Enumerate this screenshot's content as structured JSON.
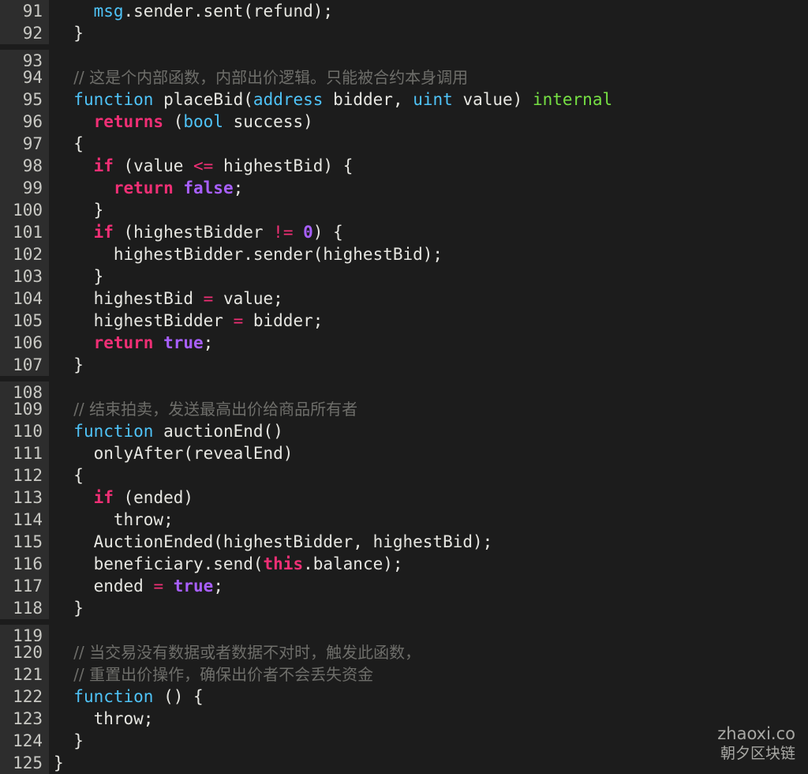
{
  "editor": {
    "language": "solidity",
    "first_line_number": 91,
    "last_line_number": 125,
    "background_color": "#1c1c1c",
    "gutter_color": "#2d2d2d",
    "gutter_text_color": "#c9c9c4"
  },
  "theme": {
    "default": "#e6e6e1",
    "keyword": "#4fc3f7",
    "identifier": "#76e043",
    "control": "#ef2f75",
    "literal": "#a85fff",
    "comment": "#6e6e6a"
  },
  "watermark": {
    "line1": "zhaoxi.co",
    "line2": "朝夕区块链"
  },
  "lines": [
    {
      "num": "91",
      "tokens": [
        {
          "t": "    ",
          "c": "default"
        },
        {
          "t": "msg",
          "c": "builtin"
        },
        {
          "t": ".sender.sent(refund);",
          "c": "default"
        }
      ]
    },
    {
      "num": "92",
      "tokens": [
        {
          "t": "  }",
          "c": "default"
        }
      ]
    },
    {
      "num": "93",
      "tokens": [
        {
          "t": "",
          "c": "default"
        }
      ]
    },
    {
      "num": "94",
      "tokens": [
        {
          "t": "  ",
          "c": "default"
        },
        {
          "t": "// 这是个内部函数，内部出价逻辑。只能被合约本身调用",
          "c": "comment",
          "cjk": true
        }
      ]
    },
    {
      "num": "95",
      "tokens": [
        {
          "t": "  ",
          "c": "default"
        },
        {
          "t": "function",
          "c": "keyword"
        },
        {
          "t": " ",
          "c": "default"
        },
        {
          "t": "placeBid",
          "c": "identifier"
        },
        {
          "t": "(",
          "c": "default"
        },
        {
          "t": "address",
          "c": "type"
        },
        {
          "t": " bidder, ",
          "c": "default"
        },
        {
          "t": "uint",
          "c": "type"
        },
        {
          "t": " value) ",
          "c": "default"
        },
        {
          "t": "internal",
          "c": "modifier"
        }
      ]
    },
    {
      "num": "96",
      "tokens": [
        {
          "t": "    ",
          "c": "default"
        },
        {
          "t": "returns",
          "c": "control"
        },
        {
          "t": " (",
          "c": "default"
        },
        {
          "t": "bool",
          "c": "type"
        },
        {
          "t": " success)",
          "c": "default"
        }
      ]
    },
    {
      "num": "97",
      "tokens": [
        {
          "t": "  {",
          "c": "default"
        }
      ]
    },
    {
      "num": "98",
      "tokens": [
        {
          "t": "    ",
          "c": "default"
        },
        {
          "t": "if",
          "c": "control"
        },
        {
          "t": " (value ",
          "c": "default"
        },
        {
          "t": "<=",
          "c": "operator"
        },
        {
          "t": " highestBid) {",
          "c": "default"
        }
      ]
    },
    {
      "num": "99",
      "tokens": [
        {
          "t": "      ",
          "c": "default"
        },
        {
          "t": "return",
          "c": "control"
        },
        {
          "t": " ",
          "c": "default"
        },
        {
          "t": "false",
          "c": "literal"
        },
        {
          "t": ";",
          "c": "default"
        }
      ]
    },
    {
      "num": "100",
      "tokens": [
        {
          "t": "    }",
          "c": "default"
        }
      ]
    },
    {
      "num": "101",
      "tokens": [
        {
          "t": "    ",
          "c": "default"
        },
        {
          "t": "if",
          "c": "control"
        },
        {
          "t": " (highestBidder ",
          "c": "default"
        },
        {
          "t": "!=",
          "c": "operator"
        },
        {
          "t": " ",
          "c": "default"
        },
        {
          "t": "0",
          "c": "literal"
        },
        {
          "t": ") {",
          "c": "default"
        }
      ]
    },
    {
      "num": "102",
      "tokens": [
        {
          "t": "      highestBidder.sender(highestBid);",
          "c": "default"
        }
      ]
    },
    {
      "num": "103",
      "tokens": [
        {
          "t": "    }",
          "c": "default"
        }
      ]
    },
    {
      "num": "104",
      "tokens": [
        {
          "t": "    highestBid ",
          "c": "default"
        },
        {
          "t": "=",
          "c": "operator"
        },
        {
          "t": " value;",
          "c": "default"
        }
      ]
    },
    {
      "num": "105",
      "tokens": [
        {
          "t": "    highestBidder ",
          "c": "default"
        },
        {
          "t": "=",
          "c": "operator"
        },
        {
          "t": " bidder;",
          "c": "default"
        }
      ]
    },
    {
      "num": "106",
      "tokens": [
        {
          "t": "    ",
          "c": "default"
        },
        {
          "t": "return",
          "c": "control"
        },
        {
          "t": " ",
          "c": "default"
        },
        {
          "t": "true",
          "c": "literal"
        },
        {
          "t": ";",
          "c": "default"
        }
      ]
    },
    {
      "num": "107",
      "tokens": [
        {
          "t": "  }",
          "c": "default"
        }
      ]
    },
    {
      "num": "108",
      "tokens": [
        {
          "t": "",
          "c": "default"
        }
      ]
    },
    {
      "num": "109",
      "tokens": [
        {
          "t": "  ",
          "c": "default"
        },
        {
          "t": "// 结束拍卖，发送最高出价给商品所有者",
          "c": "comment",
          "cjk": true
        }
      ]
    },
    {
      "num": "110",
      "tokens": [
        {
          "t": "  ",
          "c": "default"
        },
        {
          "t": "function",
          "c": "keyword"
        },
        {
          "t": " ",
          "c": "default"
        },
        {
          "t": "auctionEnd",
          "c": "identifier"
        },
        {
          "t": "()",
          "c": "default"
        }
      ]
    },
    {
      "num": "111",
      "tokens": [
        {
          "t": "    ",
          "c": "default"
        },
        {
          "t": "onlyAfter",
          "c": "identifier"
        },
        {
          "t": "(revealEnd)",
          "c": "default"
        }
      ]
    },
    {
      "num": "112",
      "tokens": [
        {
          "t": "  {",
          "c": "default"
        }
      ]
    },
    {
      "num": "113",
      "tokens": [
        {
          "t": "    ",
          "c": "default"
        },
        {
          "t": "if",
          "c": "control"
        },
        {
          "t": " (ended)",
          "c": "default"
        }
      ]
    },
    {
      "num": "114",
      "tokens": [
        {
          "t": "      throw;",
          "c": "default"
        }
      ]
    },
    {
      "num": "115",
      "tokens": [
        {
          "t": "    AuctionEnded(highestBidder, highestBid);",
          "c": "default"
        }
      ]
    },
    {
      "num": "116",
      "tokens": [
        {
          "t": "    beneficiary.send(",
          "c": "default"
        },
        {
          "t": "this",
          "c": "control"
        },
        {
          "t": ".balance);",
          "c": "default"
        }
      ]
    },
    {
      "num": "117",
      "tokens": [
        {
          "t": "    ended ",
          "c": "default"
        },
        {
          "t": "=",
          "c": "operator"
        },
        {
          "t": " ",
          "c": "default"
        },
        {
          "t": "true",
          "c": "literal"
        },
        {
          "t": ";",
          "c": "default"
        }
      ]
    },
    {
      "num": "118",
      "tokens": [
        {
          "t": "  }",
          "c": "default"
        }
      ]
    },
    {
      "num": "119",
      "tokens": [
        {
          "t": "",
          "c": "default"
        }
      ]
    },
    {
      "num": "120",
      "tokens": [
        {
          "t": "  ",
          "c": "default"
        },
        {
          "t": "// 当交易没有数据或者数据不对时，触发此函数，",
          "c": "comment",
          "cjk": true
        }
      ]
    },
    {
      "num": "121",
      "tokens": [
        {
          "t": "  ",
          "c": "default"
        },
        {
          "t": "// 重置出价操作，确保出价者不会丢失资金",
          "c": "comment",
          "cjk": true
        }
      ]
    },
    {
      "num": "122",
      "tokens": [
        {
          "t": "  ",
          "c": "default"
        },
        {
          "t": "function",
          "c": "keyword"
        },
        {
          "t": " () {",
          "c": "default"
        }
      ]
    },
    {
      "num": "123",
      "tokens": [
        {
          "t": "    throw;",
          "c": "default"
        }
      ]
    },
    {
      "num": "124",
      "tokens": [
        {
          "t": "  }",
          "c": "default"
        }
      ]
    },
    {
      "num": "125",
      "tokens": [
        {
          "t": "}",
          "c": "default"
        }
      ]
    }
  ]
}
